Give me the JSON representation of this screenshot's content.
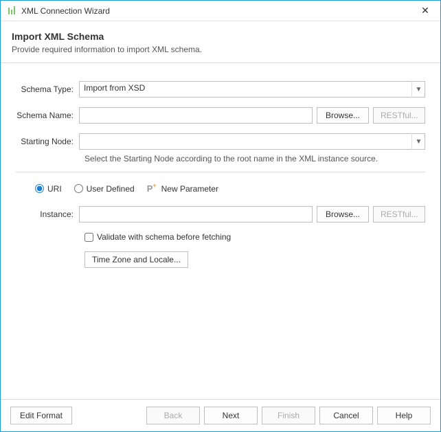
{
  "window": {
    "title": "XML Connection Wizard"
  },
  "header": {
    "title": "Import XML Schema",
    "subtitle": "Provide required information to import XML schema."
  },
  "form": {
    "schemaType": {
      "label": "Schema Type:",
      "value": "Import from XSD"
    },
    "schemaName": {
      "label": "Schema Name:",
      "value": "",
      "browse": "Browse...",
      "restful": "RESTful..."
    },
    "startingNode": {
      "label": "Starting Node:",
      "value": "",
      "helper": "Select the Starting Node according to the root name in the XML instance source."
    },
    "sourceMode": {
      "uri": "URI",
      "userDefined": "User Defined",
      "newParam": "New Parameter",
      "selected": "uri"
    },
    "instance": {
      "label": "Instance:",
      "value": "",
      "browse": "Browse...",
      "restful": "RESTful..."
    },
    "validate": {
      "checked": false,
      "label": "Validate with schema before fetching"
    },
    "tzLocale": {
      "label": "Time Zone and Locale..."
    }
  },
  "footer": {
    "editFormat": "Edit Format",
    "back": "Back",
    "next": "Next",
    "finish": "Finish",
    "cancel": "Cancel",
    "help": "Help"
  }
}
